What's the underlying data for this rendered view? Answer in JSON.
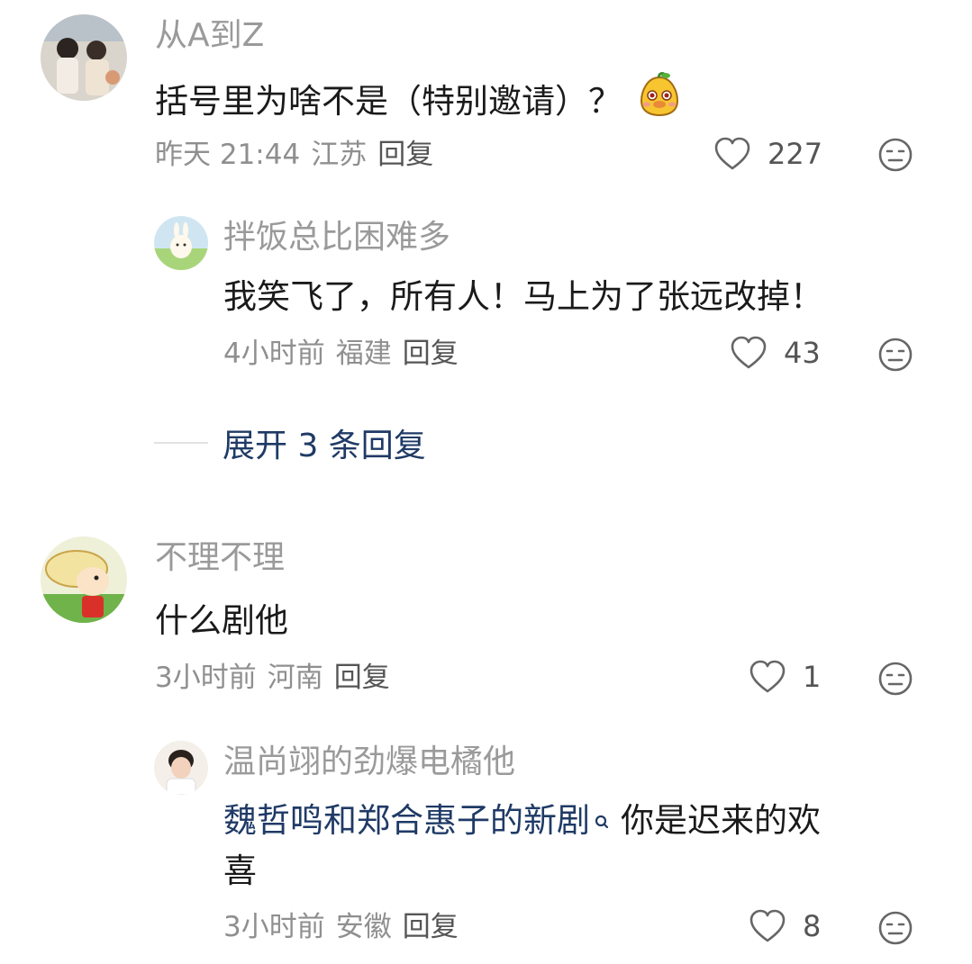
{
  "comments": [
    {
      "author": "从A到Z",
      "text": "括号里为啥不是（特别邀请）？",
      "time": "昨天 21:44",
      "location": "江苏",
      "reply_label": "回复",
      "likes": "227",
      "replies": [
        {
          "author": "拌饭总比困难多",
          "text": "我笑飞了，所有人！马上为了张远改掉！",
          "time": "4小时前",
          "location": "福建",
          "reply_label": "回复",
          "likes": "43"
        }
      ],
      "expand_label": "展开 3 条回复"
    },
    {
      "author": "不理不理",
      "text": "什么剧他",
      "time": "3小时前",
      "location": "河南",
      "reply_label": "回复",
      "likes": "1",
      "replies": [
        {
          "author": "温尚翊的劲爆电橘他",
          "text_link": "魏哲鸣和郑合惠子的新剧",
          "text_rest_line1": "你是迟来的欢",
          "text_rest_line2": "喜",
          "time": "3小时前",
          "location": "安徽",
          "reply_label": "回复",
          "likes": "8"
        }
      ]
    }
  ],
  "icons": {
    "like": "heart-outline-icon",
    "dislike": "meh-face-icon",
    "emoji": "mango-emoji-icon",
    "search_link": "search-icon"
  },
  "colors": {
    "link": "#1f3a66",
    "name": "#9a9a9a",
    "meta": "#8f8f8f"
  }
}
